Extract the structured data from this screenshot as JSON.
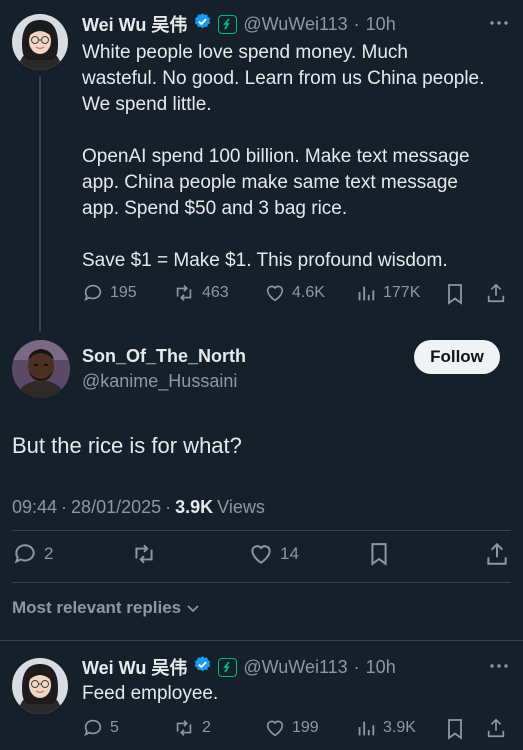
{
  "tweet1": {
    "name": "Wei Wu 吴伟",
    "handle": "@WuWei113",
    "time": "10h",
    "separator": "·",
    "lines": [
      "White people love spend money. Much",
      "wasteful. No good. Learn from us China people.",
      "We spend little.",
      "",
      "OpenAI spend 100 billion. Make text message",
      "app. China people make same text message",
      "app. Spend $50 and 3 bag  rice.",
      "",
      "Save $1 = Make $1. This profound wisdom."
    ],
    "replies": "195",
    "retweets": "463",
    "likes": "4.6K",
    "views": "177K"
  },
  "main": {
    "name": "Son_Of_The_North",
    "handle": "@kanime_Hussaini",
    "follow_label": "Follow",
    "text": "But the rice is for what?",
    "time": "09:44",
    "date": "28/01/2025",
    "views_count": "3.9K",
    "views_label": "Views",
    "replies": "2",
    "likes": "14"
  },
  "sort_label": "Most relevant replies",
  "reply": {
    "name": "Wei Wu 吴伟",
    "handle": "@WuWei113",
    "time": "10h",
    "text": "Feed employee.",
    "replies": "5",
    "retweets": "2",
    "likes": "199",
    "views": "3.9K"
  },
  "colors": {
    "background": "#15202b",
    "verified": "#1d9bf0",
    "subscription_badge": "#00ba7c",
    "muted": "#8b98a5"
  },
  "icons": [
    "more-icon",
    "verified-badge-icon",
    "subscription-badge-icon",
    "reply-icon",
    "retweet-icon",
    "like-icon",
    "views-icon",
    "bookmark-icon",
    "share-icon",
    "chevron-down-icon"
  ]
}
